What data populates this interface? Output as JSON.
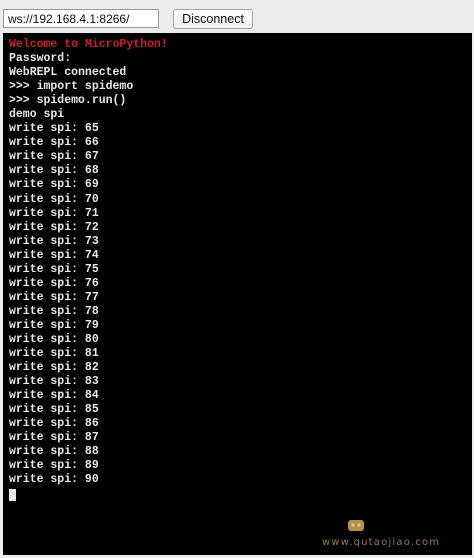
{
  "connection": {
    "url": "ws://192.168.4.1:8266/",
    "button_label": "Disconnect"
  },
  "terminal": {
    "welcome": "Welcome to MicroPython!",
    "lines": [
      "Password:",
      "WebREPL connected",
      ">>> import spidemo",
      ">>> spidemo.run()",
      "demo spi",
      "write spi: 65",
      "write spi: 66",
      "write spi: 67",
      "write spi: 68",
      "write spi: 69",
      "write spi: 70",
      "write spi: 71",
      "write spi: 72",
      "write spi: 73",
      "write spi: 74",
      "write spi: 75",
      "write spi: 76",
      "write spi: 77",
      "write spi: 78",
      "write spi: 79",
      "write spi: 80",
      "write spi: 81",
      "write spi: 82",
      "write spi: 83",
      "write spi: 84",
      "write spi: 85",
      "write spi: 86",
      "write spi: 87",
      "write spi: 88",
      "write spi: 89",
      "write spi: 90"
    ]
  },
  "watermark": {
    "text": "www.qutaojiao.com"
  },
  "colors": {
    "welcome": "#d11b1b",
    "terminal_bg": "#000000",
    "terminal_fg": "#e8e8e8"
  }
}
